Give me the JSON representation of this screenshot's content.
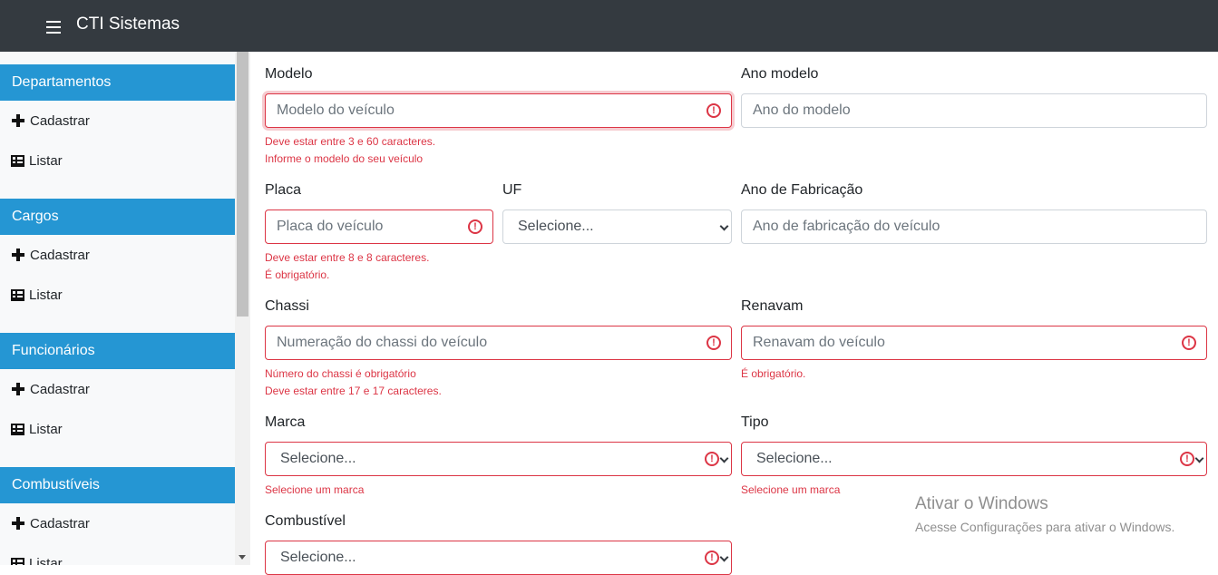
{
  "navbar": {
    "brand": "CTI Sistemas",
    "menu_icon": "hamburger-icon"
  },
  "sidebar": {
    "sections": [
      {
        "title": "Departamentos",
        "items": [
          "Cadastrar",
          "Listar"
        ]
      },
      {
        "title": "Cargos",
        "items": [
          "Cadastrar",
          "Listar"
        ]
      },
      {
        "title": "Funcionários",
        "items": [
          "Cadastrar",
          "Listar"
        ]
      },
      {
        "title": "Combustíveis",
        "items": [
          "Cadastrar",
          "Listar"
        ]
      }
    ]
  },
  "form": {
    "modelo": {
      "label": "Modelo",
      "placeholder": "Modelo do veículo",
      "errors": [
        "Deve estar entre 3 e 60 caracteres.",
        "Informe o modelo do seu veículo"
      ]
    },
    "ano_modelo": {
      "label": "Ano modelo",
      "placeholder": "Ano do modelo"
    },
    "placa": {
      "label": "Placa",
      "placeholder": "Placa do veículo",
      "errors": [
        "Deve estar entre 8 e 8 caracteres.",
        "É obrigatório."
      ]
    },
    "uf": {
      "label": "UF",
      "value": "Selecione..."
    },
    "ano_fabricacao": {
      "label": "Ano de Fabricação",
      "placeholder": "Ano de fabricação do veículo"
    },
    "chassi": {
      "label": "Chassi",
      "placeholder": "Numeração do chassi do veículo",
      "errors": [
        "Número do chassi é obrigatório",
        "Deve estar entre 17 e 17 caracteres."
      ]
    },
    "renavam": {
      "label": "Renavam",
      "placeholder": "Renavam do veículo",
      "errors": [
        "É obrigatório."
      ]
    },
    "marca": {
      "label": "Marca",
      "value": "Selecione...",
      "errors": [
        "Selecione um marca"
      ]
    },
    "tipo": {
      "label": "Tipo",
      "value": "Selecione...",
      "errors": [
        "Selecione um marca"
      ]
    },
    "combustivel": {
      "label": "Combustível",
      "value": "Selecione..."
    }
  },
  "watermark": {
    "title": "Ativar o Windows",
    "subtitle": "Acesse Configurações para ativar o Windows."
  },
  "colors": {
    "navbar": "#343a40",
    "sidebar_header": "#2596d3",
    "error": "#dc3545"
  }
}
